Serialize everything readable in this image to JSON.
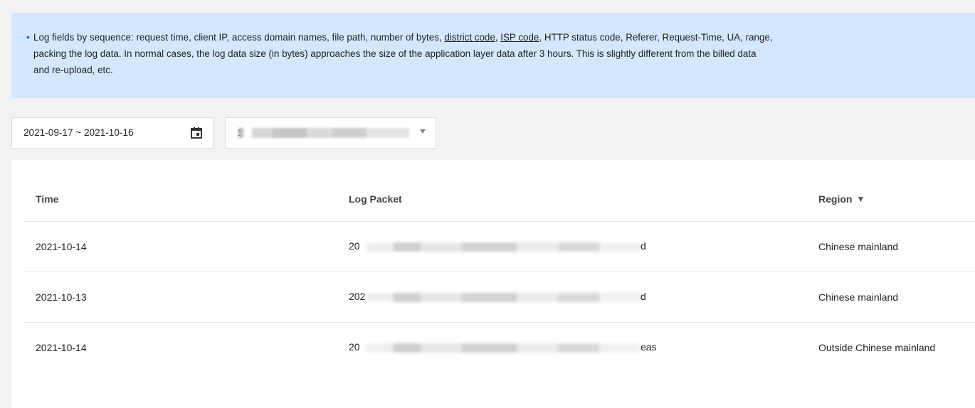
{
  "notice": {
    "text_before_district": "Log fields by sequence: request time, client IP, access domain names, file path, number of bytes,",
    "district_link": "district code",
    "isp_link": "ISP code",
    "text_after_isp": ", HTTP status code, Referer, Request-Time, UA, range,",
    "line2": "packing the log data. In normal cases, the log data size (in bytes) approaches the size of the application layer data after 3 hours. This is slightly different from the billed data",
    "line3": "and re-upload, etc."
  },
  "filters": {
    "date_range": "2021-09-17 ~ 2021-10-16",
    "domain_select_prefix": "1"
  },
  "table": {
    "headers": {
      "time": "Time",
      "log_packet": "Log Packet",
      "region": "Region"
    },
    "rows": [
      {
        "time": "2021-10-14",
        "packet_prefix": "20",
        "packet_suffix": "d",
        "region": "Chinese mainland"
      },
      {
        "time": "2021-10-13",
        "packet_prefix": "202",
        "packet_suffix": "d",
        "region": "Chinese mainland"
      },
      {
        "time": "2021-10-14",
        "packet_prefix": "20",
        "packet_suffix": "eas",
        "region": "Outside Chinese mainland"
      }
    ]
  },
  "icons": {
    "calendar": "calendar-icon",
    "caret": "chevron-down-icon",
    "filter": "filter-icon"
  },
  "colors": {
    "notice_bg": "#d5e7ff",
    "accent": "#006eff"
  }
}
